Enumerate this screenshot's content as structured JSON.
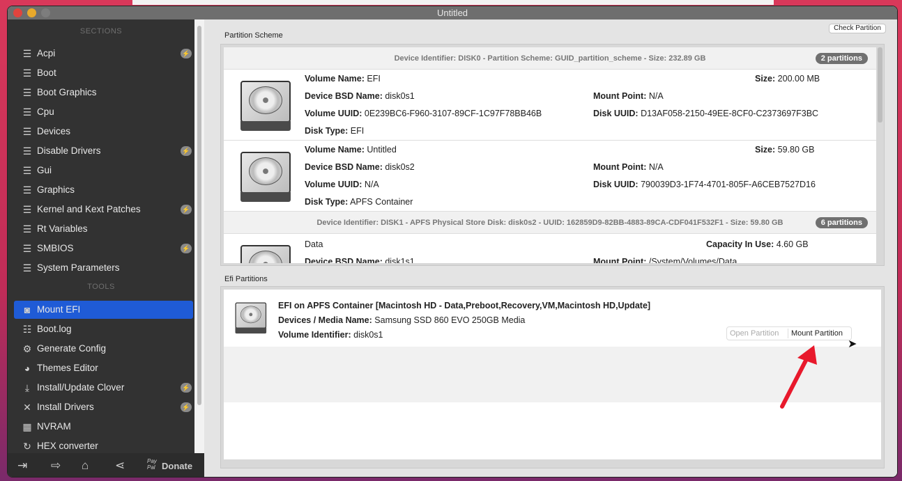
{
  "window": {
    "title": "Untitled"
  },
  "sidebar": {
    "sections_header": "SECTIONS",
    "sections": [
      {
        "label": "Acpi",
        "icon": "list-icon",
        "badge": true
      },
      {
        "label": "Boot",
        "icon": "list-icon",
        "badge": false
      },
      {
        "label": "Boot Graphics",
        "icon": "list-icon",
        "badge": false
      },
      {
        "label": "Cpu",
        "icon": "list-icon",
        "badge": false
      },
      {
        "label": "Devices",
        "icon": "list-icon",
        "badge": false
      },
      {
        "label": "Disable Drivers",
        "icon": "list-icon",
        "badge": true
      },
      {
        "label": "Gui",
        "icon": "list-icon",
        "badge": false
      },
      {
        "label": "Graphics",
        "icon": "list-icon",
        "badge": false
      },
      {
        "label": "Kernel and Kext Patches",
        "icon": "list-icon",
        "badge": true
      },
      {
        "label": "Rt Variables",
        "icon": "list-icon",
        "badge": false
      },
      {
        "label": "SMBIOS",
        "icon": "list-icon",
        "badge": true
      },
      {
        "label": "System Parameters",
        "icon": "list-icon",
        "badge": false
      }
    ],
    "tools_header": "TOOLS",
    "tools": [
      {
        "label": "Mount EFI",
        "icon": "disk-icon",
        "selected": true
      },
      {
        "label": "Boot.log",
        "icon": "log-search-icon"
      },
      {
        "label": "Generate Config",
        "icon": "gears-icon"
      },
      {
        "label": "Themes Editor",
        "icon": "palette-icon"
      },
      {
        "label": "Install/Update Clover",
        "icon": "download-icon",
        "badge": true
      },
      {
        "label": "Install Drivers",
        "icon": "tools-icon",
        "badge": true
      },
      {
        "label": "NVRAM",
        "icon": "chip-icon"
      },
      {
        "label": "HEX converter",
        "icon": "refresh-icon"
      }
    ],
    "bottom": {
      "paypal": "Pay Pal",
      "donate": "Donate"
    }
  },
  "partition_scheme": {
    "label": "Partition Scheme",
    "check_button": "Check Partition",
    "devices": [
      {
        "header": "Device Identifier: DISK0 - Partition Scheme: GUID_partition_scheme - Size: 232.89 GB",
        "count": "2 partitions",
        "volumes": [
          {
            "volume_name": "EFI",
            "size": "200.00 MB",
            "bsd": "disk0s1",
            "mount": "N/A",
            "vuuid": "0E239BC6-F960-3107-89CF-1C97F78BB46B",
            "duuid": "D13AF058-2150-49EE-8CF0-C2373697F3BC",
            "type": "EFI"
          },
          {
            "volume_name": "Untitled",
            "size": "59.80 GB",
            "bsd": "disk0s2",
            "mount": "N/A",
            "vuuid": "N/A",
            "duuid": "790039D3-1F74-4701-805F-A6CEB7527D16",
            "type": "APFS Container"
          }
        ]
      },
      {
        "header": "Device Identifier: DISK1 - APFS Physical Store Disk: disk0s2 - UUID: 162859D9-82BB-4883-89CA-CDF041F532F1 - Size: 59.80 GB",
        "count": "6 partitions",
        "volumes": [
          {
            "name": "Data",
            "capacity": "4.60 GB",
            "bsd": "disk1s1",
            "mount": "/System/Volumes/Data"
          }
        ]
      }
    ],
    "labels": {
      "volume_name": "Volume Name:",
      "size": "Size:",
      "bsd": "Device BSD Name:",
      "mount": "Mount Point:",
      "vuuid": "Volume UUID:",
      "duuid": "Disk UUID:",
      "type": "Disk Type:",
      "capacity": "Capacity In Use:"
    }
  },
  "efi": {
    "label": "Efi Partitions",
    "title": "EFI on APFS Container [Macintosh HD - Data,Preboot,Recovery,VM,Macintosh HD,Update]",
    "media_label": "Devices / Media Name:",
    "media": "Samsung SSD 860 EVO 250GB Media",
    "vol_label": "Volume Identifier:",
    "vol": "disk0s1",
    "open_button": "Open Partition",
    "mount_button": "Mount Partition"
  },
  "colors": {
    "selection": "#1f5bd6",
    "annotation_arrow": "#e8192c"
  }
}
